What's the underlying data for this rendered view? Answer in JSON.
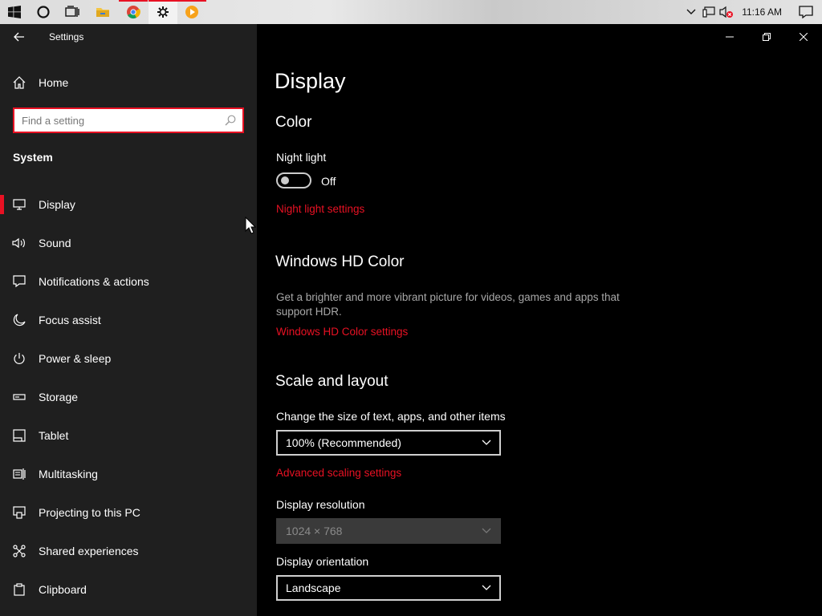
{
  "taskbar": {
    "start_icon": "windows-logo-icon",
    "clock": "11:16 AM"
  },
  "window": {
    "title": "Settings"
  },
  "nav": {
    "home_label": "Home",
    "search_placeholder": "Find a setting",
    "search_value": "",
    "section_label": "System",
    "items": [
      {
        "label": "Display",
        "icon": "monitor-icon",
        "selected": true
      },
      {
        "label": "Sound",
        "icon": "speaker-icon"
      },
      {
        "label": "Notifications & actions",
        "icon": "message-icon"
      },
      {
        "label": "Focus assist",
        "icon": "moon-icon"
      },
      {
        "label": "Power & sleep",
        "icon": "power-icon"
      },
      {
        "label": "Storage",
        "icon": "storage-icon"
      },
      {
        "label": "Tablet",
        "icon": "tablet-icon"
      },
      {
        "label": "Multitasking",
        "icon": "multitasking-icon"
      },
      {
        "label": "Projecting to this PC",
        "icon": "projecting-icon"
      },
      {
        "label": "Shared experiences",
        "icon": "shared-icon"
      },
      {
        "label": "Clipboard",
        "icon": "clipboard-icon"
      }
    ]
  },
  "main": {
    "title": "Display",
    "color": {
      "heading": "Color",
      "night_light_label": "Night light",
      "night_light_state": "Off",
      "night_light_link": "Night light settings"
    },
    "hdr": {
      "heading": "Windows HD Color",
      "description": "Get a brighter and more vibrant picture for videos, games and apps that support HDR.",
      "link": "Windows HD Color settings"
    },
    "scale": {
      "heading": "Scale and layout",
      "size_label": "Change the size of text, apps, and other items",
      "size_value": "100% (Recommended)",
      "advanced_link": "Advanced scaling settings",
      "resolution_label": "Display resolution",
      "resolution_value": "1024 × 768",
      "orientation_label": "Display orientation",
      "orientation_value": "Landscape"
    }
  },
  "colors": {
    "accent": "#e81123",
    "nav_bg": "#1f1f1f",
    "content_bg": "#000000"
  }
}
